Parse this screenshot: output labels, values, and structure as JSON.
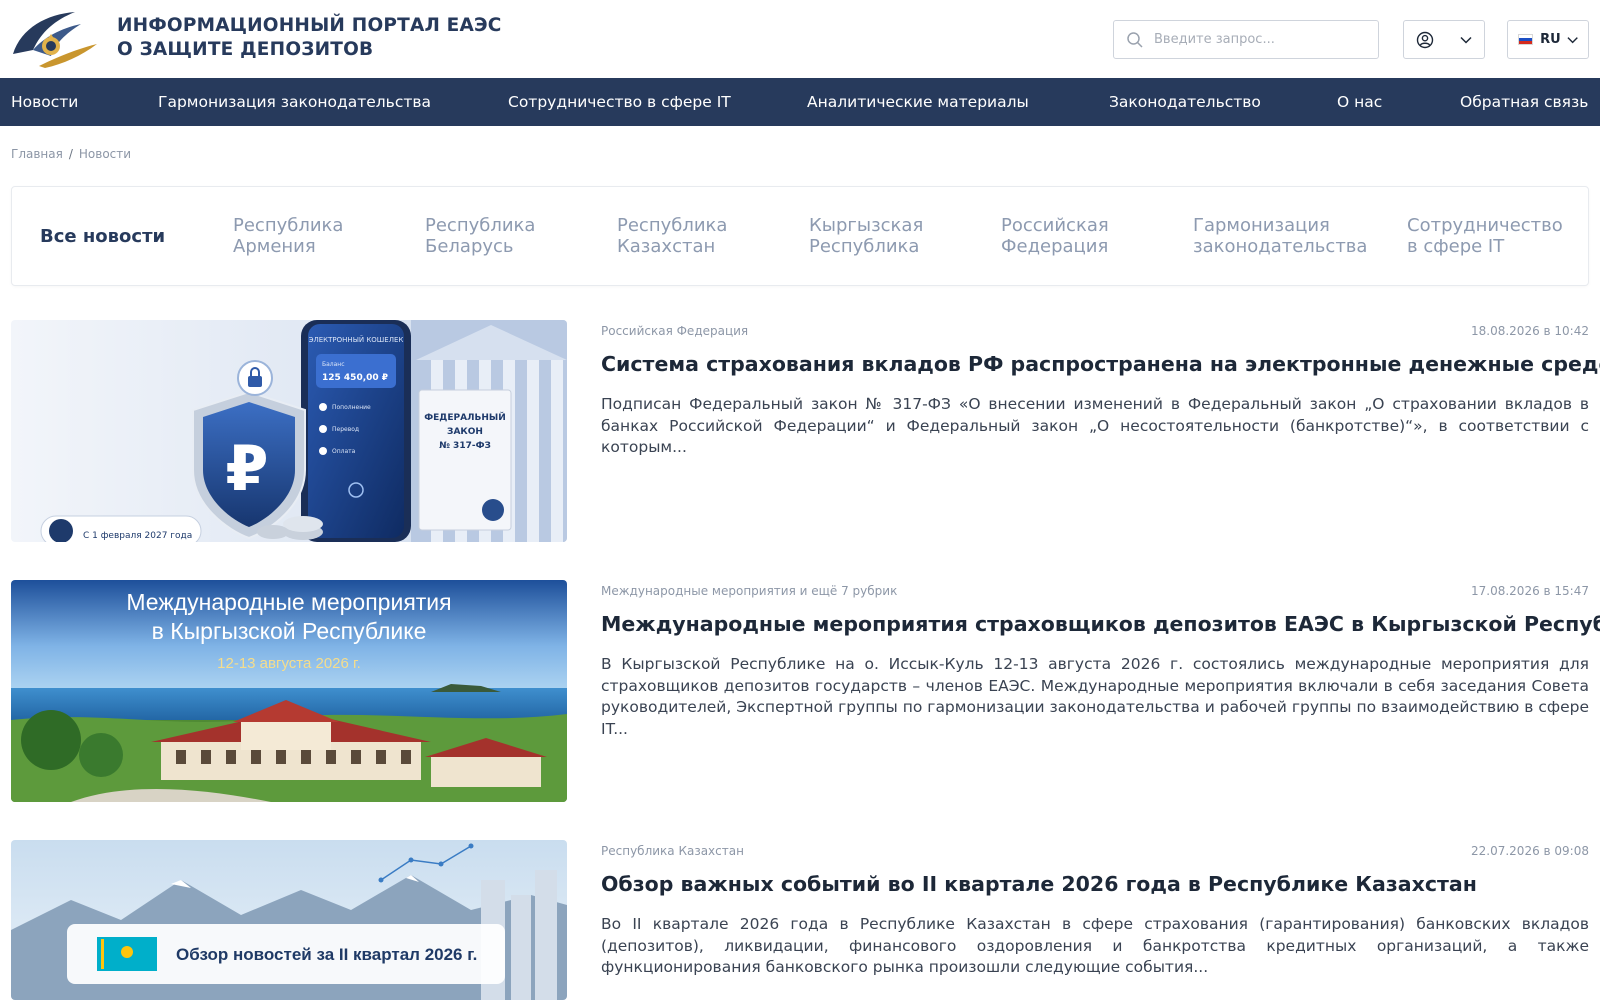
{
  "header": {
    "logo_line1": "ИНФОРМАЦИОННЫЙ ПОРТАЛ ЕАЭС",
    "logo_line2": "О ЗАЩИТЕ ДЕПОЗИТОВ",
    "search_placeholder": "Введите запрос...",
    "lang": "RU"
  },
  "nav": {
    "items": [
      "Новости",
      "Гармонизация законодательства",
      "Сотрудничество в сфере IT",
      "Аналитические материалы",
      "Законодательство",
      "О нас",
      "Обратная связь"
    ]
  },
  "breadcrumb": {
    "home": "Главная",
    "separator": "/",
    "current": "Новости"
  },
  "filters": {
    "active": "Все новости",
    "tabs": [
      [
        "Республика",
        "Армения"
      ],
      [
        "Республика",
        "Беларусь"
      ],
      [
        "Республика",
        "Казахстан"
      ],
      [
        "Кыргызская",
        "Республика"
      ],
      [
        "Российская",
        "Федерация"
      ],
      [
        "Гармонизация",
        "законодательства"
      ],
      [
        "Сотрудничество",
        "в сфере IT"
      ]
    ]
  },
  "news": [
    {
      "category": "Российская Федерация",
      "date": "18.08.2026 в 10:42",
      "title": "Система страхования вкладов РФ распространена на электронные денежные средства",
      "text": "Подписан Федеральный закон № 317-ФЗ «О внесении изменений в Федеральный закон „О страховании вкладов в банках Российской Федерации“ и Федеральный закон „О несостоятельности (банкротстве)“», в соответствии с которым...",
      "image": {
        "wallet_label": "ЭЛЕКТРОННЫЙ КОШЕЛЕК",
        "balance_label": "Баланс",
        "balance": "125 450,00 ₽",
        "menu1": "Пополнение",
        "menu2": "Перевод",
        "menu3": "Оплата",
        "doc_line1": "ФЕДЕРАЛЬНЫЙ",
        "doc_line2": "ЗАКОН",
        "doc_line3": "№ 317-ФЗ",
        "badge": "С 1 февраля 2027 года",
        "currency": "₽"
      }
    },
    {
      "category": "Международные мероприятия и ещё 7 рубрик",
      "date": "17.08.2026 в 15:47",
      "title": "Международные мероприятия страховщиков депозитов ЕАЭС в Кыргызской Республике",
      "text": "В Кыргызской Республике на о. Иссык-Куль 12-13 августа 2026 г. состоялись международные мероприятия для страховщиков депозитов государств – членов ЕАЭС. Международные мероприятия включали в себя заседания Совета руководителей, Экспертной группы по гармонизации законодательства и рабочей группы по взаимодействию в сфере IT...",
      "image": {
        "line1": "Международные мероприятия",
        "line2": "в Кыргызской Республике",
        "dates": "12-13 августа 2026 г."
      }
    },
    {
      "category": "Республика Казахстан",
      "date": "22.07.2026 в 09:08",
      "title": "Обзор важных событий во II квартале 2026 года в Республике Казахстан",
      "text": "Во II квартале 2026 года в Республике Казахстан в сфере страхования (гарантирования) банковских вкладов (депозитов), ликвидации, финансового оздоровления и банкротства кредитных организаций, а также функционирования банковского рынка произошли следующие события...",
      "image": {
        "banner": "Обзор новостей за II квартал 2026 г."
      }
    }
  ],
  "colors": {
    "brand_navy": "#273a5c",
    "logo_gold": "#c9962e",
    "muted_text": "#8d97a7"
  }
}
